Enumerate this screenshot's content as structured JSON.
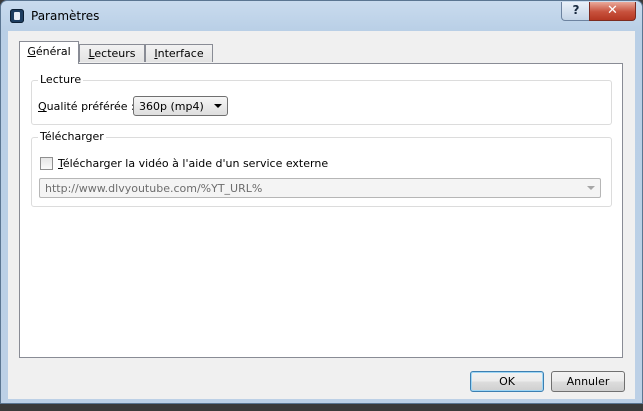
{
  "window": {
    "title": "Paramètres",
    "help_label": "?",
    "close_label": "✕"
  },
  "tabs": [
    {
      "label": "Général",
      "mnemonic": "G",
      "rest": "énéral",
      "active": true
    },
    {
      "label": "Lecteurs",
      "mnemonic": "L",
      "rest": "ecteurs",
      "active": false
    },
    {
      "label": "Interface",
      "mnemonic": "I",
      "rest": "nterface",
      "active": false
    }
  ],
  "lecture": {
    "legend": "Lecture",
    "quality_label_mnemonic": "Q",
    "quality_label_rest": "ualité préférée :",
    "quality_value": "360p (mp4)"
  },
  "telecharger": {
    "legend": "Télécharger",
    "checkbox_mnemonic": "T",
    "checkbox_rest": "élécharger la vidéo à l'aide d'un service externe",
    "checkbox_checked": false,
    "url_value": "http://www.dlvyoutube.com/%YT_URL%"
  },
  "buttons": {
    "ok": "OK",
    "cancel": "Annuler"
  }
}
